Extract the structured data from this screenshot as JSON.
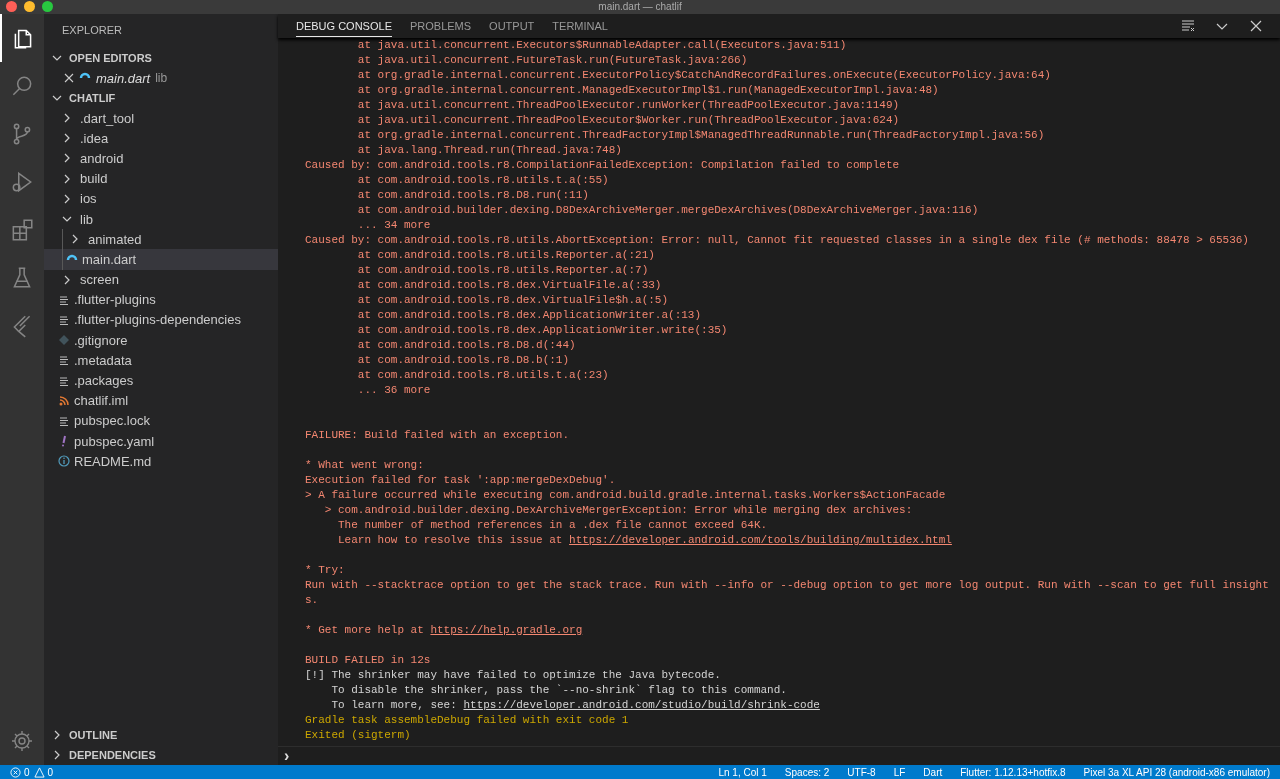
{
  "window": {
    "title": "main.dart — chatlif"
  },
  "activity_bar": [
    {
      "kind": "files",
      "selected": true
    },
    {
      "kind": "search",
      "selected": false
    },
    {
      "kind": "scm",
      "selected": false
    },
    {
      "kind": "debug",
      "selected": false
    },
    {
      "kind": "extensions",
      "selected": false
    },
    {
      "kind": "flask",
      "selected": false
    },
    {
      "kind": "flutter",
      "selected": false
    }
  ],
  "sidebar": {
    "title": "EXPLORER",
    "open_editors": {
      "title": "OPEN EDITORS",
      "expanded": true,
      "items": [
        {
          "name": "main.dart",
          "folder": "lib"
        }
      ]
    },
    "project": {
      "title": "CHATLIF",
      "expanded": true,
      "items": [
        {
          "kind": "folder",
          "name": ".dart_tool",
          "expanded": false,
          "selected": false
        },
        {
          "kind": "folder",
          "name": ".idea",
          "expanded": false,
          "selected": false
        },
        {
          "kind": "folder",
          "name": "android",
          "expanded": false,
          "selected": false
        },
        {
          "kind": "folder",
          "name": "build",
          "expanded": false,
          "selected": false
        },
        {
          "kind": "folder",
          "name": "ios",
          "expanded": false,
          "selected": false
        },
        {
          "kind": "folder",
          "name": "lib",
          "expanded": true,
          "selected": false,
          "children": [
            {
              "kind": "folder",
              "name": "animated",
              "expanded": false,
              "selected": false
            },
            {
              "kind": "dart",
              "name": "main.dart",
              "selected": true
            }
          ]
        },
        {
          "kind": "folder",
          "name": "screen",
          "expanded": false,
          "selected": false
        },
        {
          "kind": "text",
          "name": ".flutter-plugins",
          "selected": false
        },
        {
          "kind": "text",
          "name": ".flutter-plugins-dependencies",
          "selected": false
        },
        {
          "kind": "git",
          "name": ".gitignore",
          "selected": false
        },
        {
          "kind": "text",
          "name": ".metadata",
          "selected": false
        },
        {
          "kind": "text",
          "name": ".packages",
          "selected": false
        },
        {
          "kind": "rss",
          "name": "chatlif.iml",
          "selected": false
        },
        {
          "kind": "text",
          "name": "pubspec.lock",
          "selected": false
        },
        {
          "kind": "yaml",
          "name": "pubspec.yaml",
          "selected": false
        },
        {
          "kind": "info",
          "name": "README.md",
          "selected": false
        }
      ]
    },
    "bottom_sections": [
      {
        "title": "OUTLINE",
        "expanded": false
      },
      {
        "title": "DEPENDENCIES",
        "expanded": false
      }
    ]
  },
  "panel": {
    "tabs": [
      {
        "label": "DEBUG CONSOLE",
        "selected": true
      },
      {
        "label": "PROBLEMS",
        "selected": false
      },
      {
        "label": "OUTPUT",
        "selected": false
      },
      {
        "label": "TERMINAL",
        "selected": false
      }
    ],
    "lines": [
      {
        "kind": "error",
        "text": "        at java.util.concurrent.Executors$RunnableAdapter.call(Executors.java:511)"
      },
      {
        "kind": "error",
        "text": "        at java.util.concurrent.FutureTask.run(FutureTask.java:266)"
      },
      {
        "kind": "error",
        "text": "        at org.gradle.internal.concurrent.ExecutorPolicy$CatchAndRecordFailures.onExecute(ExecutorPolicy.java:64)"
      },
      {
        "kind": "error",
        "text": "        at org.gradle.internal.concurrent.ManagedExecutorImpl$1.run(ManagedExecutorImpl.java:48)"
      },
      {
        "kind": "error",
        "text": "        at java.util.concurrent.ThreadPoolExecutor.runWorker(ThreadPoolExecutor.java:1149)"
      },
      {
        "kind": "error",
        "text": "        at java.util.concurrent.ThreadPoolExecutor$Worker.run(ThreadPoolExecutor.java:624)"
      },
      {
        "kind": "error",
        "text": "        at org.gradle.internal.concurrent.ThreadFactoryImpl$ManagedThreadRunnable.run(ThreadFactoryImpl.java:56)"
      },
      {
        "kind": "error",
        "text": "        at java.lang.Thread.run(Thread.java:748)"
      },
      {
        "kind": "error",
        "text": "Caused by: com.android.tools.r8.CompilationFailedException: Compilation failed to complete"
      },
      {
        "kind": "error",
        "text": "        at com.android.tools.r8.utils.t.a(:55)"
      },
      {
        "kind": "error",
        "text": "        at com.android.tools.r8.D8.run(:11)"
      },
      {
        "kind": "error",
        "text": "        at com.android.builder.dexing.D8DexArchiveMerger.mergeDexArchives(D8DexArchiveMerger.java:116)"
      },
      {
        "kind": "error",
        "text": "        ... 34 more"
      },
      {
        "kind": "error",
        "text": "Caused by: com.android.tools.r8.utils.AbortException: Error: null, Cannot fit requested classes in a single dex file (# methods: 88478 > 65536)"
      },
      {
        "kind": "error",
        "text": "        at com.android.tools.r8.utils.Reporter.a(:21)"
      },
      {
        "kind": "error",
        "text": "        at com.android.tools.r8.utils.Reporter.a(:7)"
      },
      {
        "kind": "error",
        "text": "        at com.android.tools.r8.dex.VirtualFile.a(:33)"
      },
      {
        "kind": "error",
        "text": "        at com.android.tools.r8.dex.VirtualFile$h.a(:5)"
      },
      {
        "kind": "error",
        "text": "        at com.android.tools.r8.dex.ApplicationWriter.a(:13)"
      },
      {
        "kind": "error",
        "text": "        at com.android.tools.r8.dex.ApplicationWriter.write(:35)"
      },
      {
        "kind": "error",
        "text": "        at com.android.tools.r8.D8.d(:44)"
      },
      {
        "kind": "error",
        "text": "        at com.android.tools.r8.D8.b(:1)"
      },
      {
        "kind": "error",
        "text": "        at com.android.tools.r8.utils.t.a(:23)"
      },
      {
        "kind": "error",
        "text": "        ... 36 more"
      },
      {
        "kind": "blank"
      },
      {
        "kind": "blank"
      },
      {
        "kind": "error",
        "text": "FAILURE: Build failed with an exception."
      },
      {
        "kind": "blank"
      },
      {
        "kind": "error",
        "text": "* What went wrong:"
      },
      {
        "kind": "error",
        "text": "Execution failed for task ':app:mergeDexDebug'."
      },
      {
        "kind": "error",
        "text": "> A failure occurred while executing com.android.build.gradle.internal.tasks.Workers$ActionFacade"
      },
      {
        "kind": "error",
        "text": "   > com.android.builder.dexing.DexArchiveMergerException: Error while merging dex archives:"
      },
      {
        "kind": "error",
        "text": "     The number of method references in a .dex file cannot exceed 64K."
      },
      {
        "kind": "error",
        "text": "     Learn how to resolve this issue at ",
        "link": "https://developer.android.com/tools/building/multidex.html"
      },
      {
        "kind": "blank"
      },
      {
        "kind": "error",
        "text": "* Try:"
      },
      {
        "kind": "error",
        "text": "Run with --stacktrace option to get the stack trace. Run with --info or --debug option to get more log output. Run with --scan to get full insights."
      },
      {
        "kind": "blank"
      },
      {
        "kind": "error",
        "text": "* Get more help at ",
        "link": "https://help.gradle.org"
      },
      {
        "kind": "blank"
      },
      {
        "kind": "error",
        "text": "BUILD FAILED in 12s"
      },
      {
        "kind": "plain",
        "text": "[!] The shrinker may have failed to optimize the Java bytecode."
      },
      {
        "kind": "plain",
        "text": "    To disable the shrinker, pass the `--no-shrink` flag to this command."
      },
      {
        "kind": "plain",
        "text": "    To learn more, see: ",
        "link": "https://developer.android.com/studio/build/shrink-code"
      },
      {
        "kind": "warn",
        "text": "Gradle task assembleDebug failed with exit code 1"
      },
      {
        "kind": "warn",
        "text": "Exited (sigterm)"
      }
    ],
    "prompt": "›"
  },
  "status_bar": {
    "left": [
      {
        "kind": "errors",
        "text": "0"
      },
      {
        "kind": "warnings",
        "text": "0"
      }
    ],
    "right": [
      "Ln 1, Col 1",
      "Spaces: 2",
      "UTF-8",
      "LF",
      "Dart",
      "Flutter: 1.12.13+hotfix.8",
      "Pixel 3a XL API 28 (android-x86 emulator)"
    ]
  }
}
